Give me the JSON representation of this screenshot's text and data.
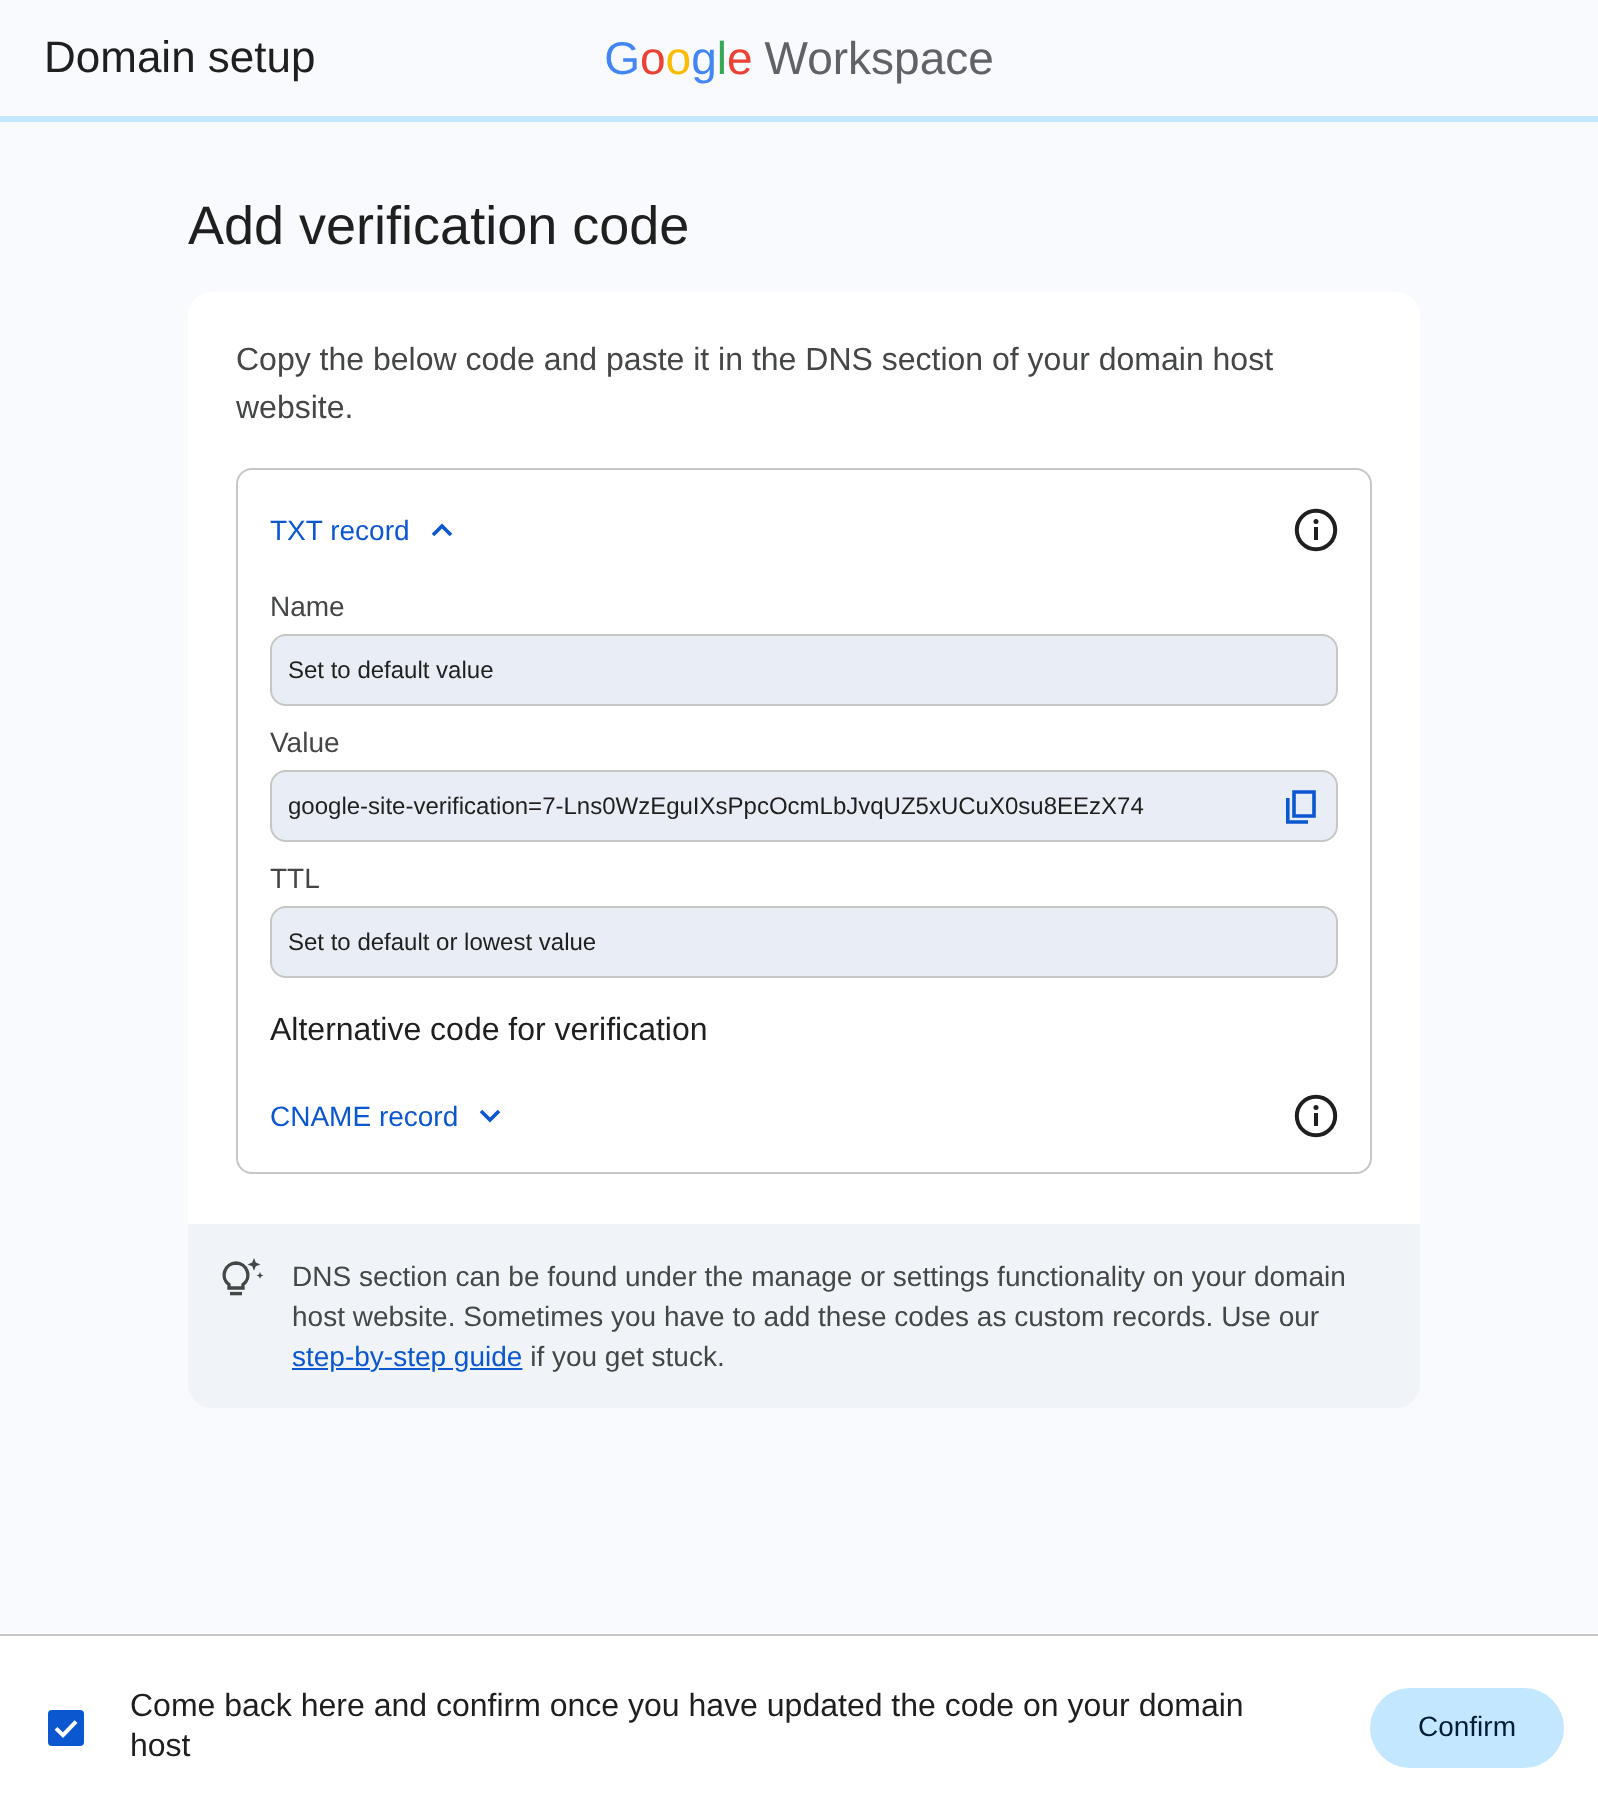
{
  "header": {
    "title": "Domain setup",
    "logo": {
      "brand": "Google",
      "product": "Workspace"
    }
  },
  "page_title": "Add verification code",
  "card": {
    "instructions": "Copy the below code and paste it in the DNS section of your domain host website.",
    "record_box": [
      {
        "kind": "record",
        "label": "TXT record",
        "expanded": true,
        "fields": [
          {
            "label": "Name",
            "value": "Set to default value",
            "copyable": false
          },
          {
            "label": "Value",
            "value": "google-site-verification=7-Lns0WzEguIXsPpcOcmLbJvqUZ5xUCuX0su8EEzX74",
            "copyable": true
          },
          {
            "label": "TTL",
            "value": "Set to default or lowest value",
            "copyable": false
          }
        ]
      },
      {
        "kind": "subheading",
        "text": "Alternative code for verification"
      },
      {
        "kind": "record",
        "label": "CNAME record",
        "expanded": false
      }
    ],
    "tip": {
      "text": "DNS section can be found under the manage or settings functionality on your domain host website. Sometimes you have to add these codes as custom records. Use our",
      "link": "step-by-step guide",
      "text_after": "if you get stuck."
    }
  },
  "footer": {
    "confirmation": {
      "label": "Come back here and confirm once you have updated the code on your domain host",
      "checked": true
    },
    "button": "Confirm"
  }
}
